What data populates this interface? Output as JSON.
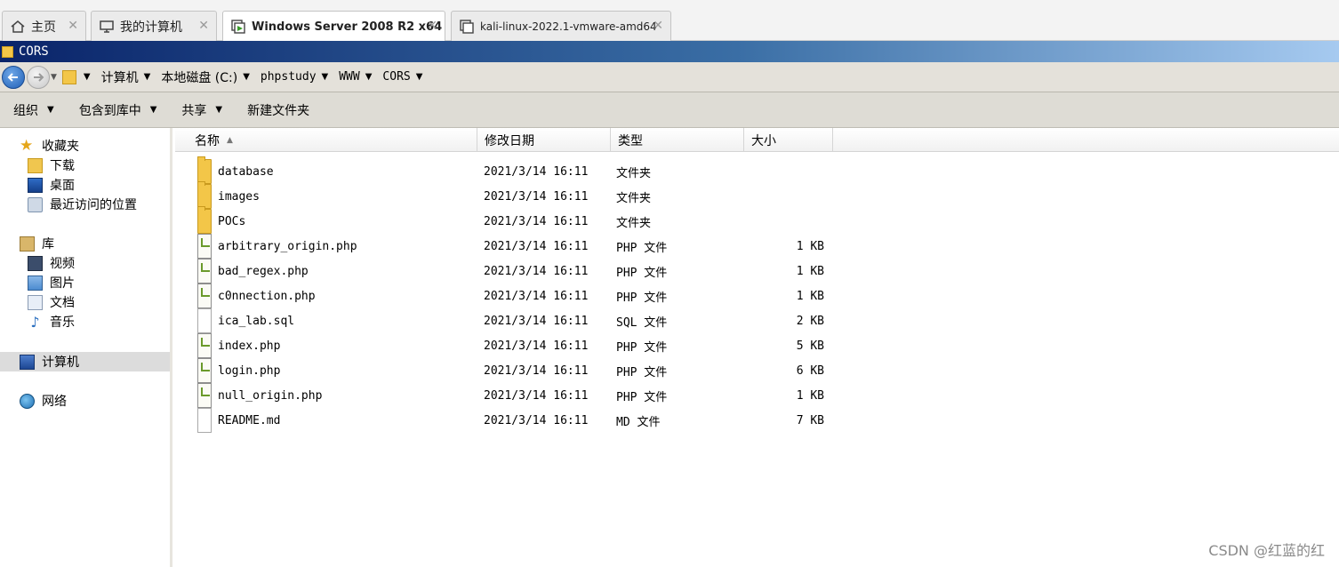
{
  "host_tabs": [
    {
      "label": "主页",
      "icon": "home-icon",
      "active": false
    },
    {
      "label": "我的计算机",
      "icon": "monitor-icon",
      "active": false
    },
    {
      "label": "Windows Server 2008 R2 x64",
      "icon": "vm-running-icon",
      "active": true
    },
    {
      "label": "kali-linux-2022.1-vmware-amd64",
      "icon": "vm-icon",
      "active": false
    }
  ],
  "window": {
    "title": "CORS"
  },
  "address": {
    "crumbs": [
      "计算机",
      "本地磁盘 (C:)",
      "phpstudy",
      "WWW",
      "CORS"
    ]
  },
  "commands": [
    {
      "label": "组织",
      "has_menu": true
    },
    {
      "label": "包含到库中",
      "has_menu": true
    },
    {
      "label": "共享",
      "has_menu": true
    },
    {
      "label": "新建文件夹",
      "has_menu": false
    }
  ],
  "nav": {
    "favorites": {
      "label": "收藏夹",
      "items": [
        "下载",
        "桌面",
        "最近访问的位置"
      ]
    },
    "libraries": {
      "label": "库",
      "items": [
        "视频",
        "图片",
        "文档",
        "音乐"
      ]
    },
    "computer": "计算机",
    "network": "网络"
  },
  "columns": {
    "name": "名称",
    "modified": "修改日期",
    "type": "类型",
    "size": "大小"
  },
  "files": [
    {
      "name": "database",
      "date": "2021/3/14 16:11",
      "type": "文件夹",
      "size": "",
      "icon": "folder-icon"
    },
    {
      "name": "images",
      "date": "2021/3/14 16:11",
      "type": "文件夹",
      "size": "",
      "icon": "folder-icon"
    },
    {
      "name": "POCs",
      "date": "2021/3/14 16:11",
      "type": "文件夹",
      "size": "",
      "icon": "folder-icon"
    },
    {
      "name": "arbitrary_origin.php",
      "date": "2021/3/14 16:11",
      "type": "PHP 文件",
      "size": "1 KB",
      "icon": "php-file-icon"
    },
    {
      "name": "bad_regex.php",
      "date": "2021/3/14 16:11",
      "type": "PHP 文件",
      "size": "1 KB",
      "icon": "php-file-icon"
    },
    {
      "name": "c0nnection.php",
      "date": "2021/3/14 16:11",
      "type": "PHP 文件",
      "size": "1 KB",
      "icon": "php-file-icon"
    },
    {
      "name": "ica_lab.sql",
      "date": "2021/3/14 16:11",
      "type": "SQL 文件",
      "size": "2 KB",
      "icon": "file-icon"
    },
    {
      "name": "index.php",
      "date": "2021/3/14 16:11",
      "type": "PHP 文件",
      "size": "5 KB",
      "icon": "php-file-icon"
    },
    {
      "name": "login.php",
      "date": "2021/3/14 16:11",
      "type": "PHP 文件",
      "size": "6 KB",
      "icon": "php-file-icon"
    },
    {
      "name": "null_origin.php",
      "date": "2021/3/14 16:11",
      "type": "PHP 文件",
      "size": "1 KB",
      "icon": "php-file-icon"
    },
    {
      "name": "README.md",
      "date": "2021/3/14 16:11",
      "type": "MD 文件",
      "size": "7 KB",
      "icon": "file-icon"
    }
  ],
  "watermark": "CSDN @红蓝的红"
}
